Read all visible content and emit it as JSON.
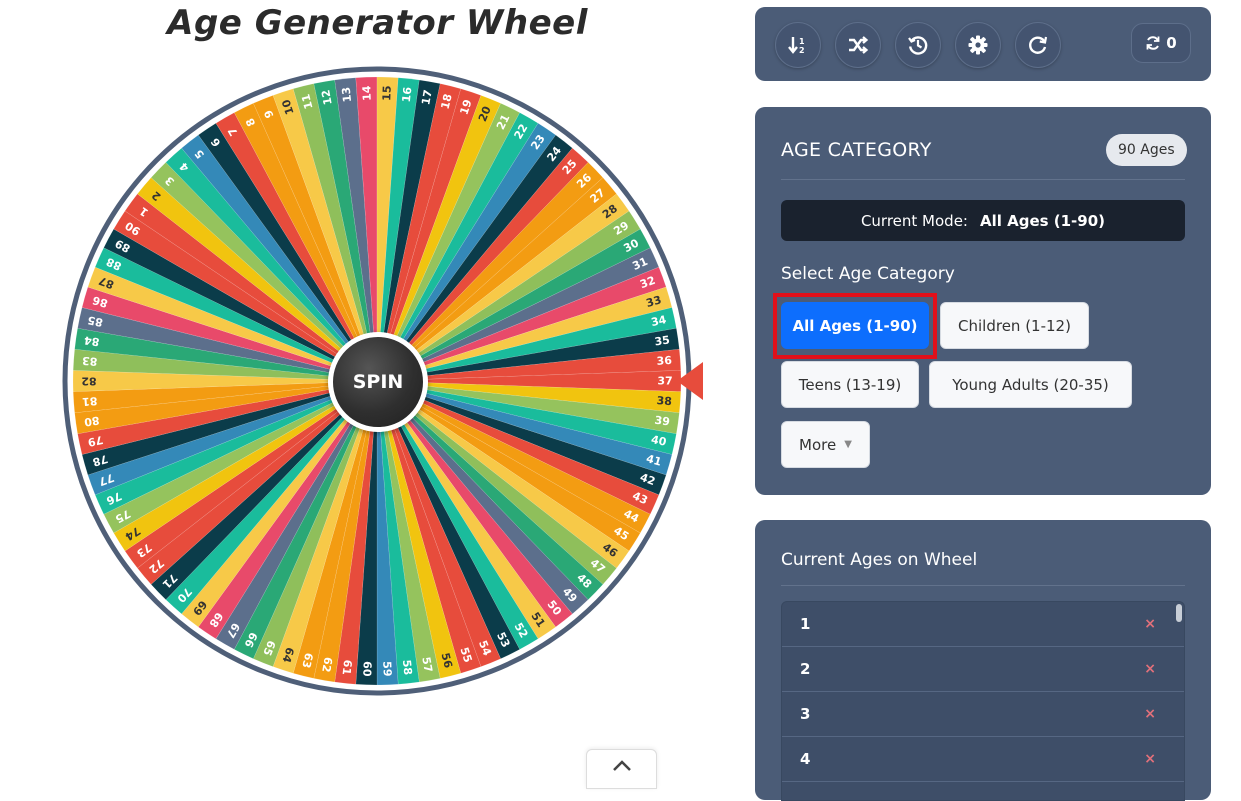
{
  "page_title": "Age Generator Wheel",
  "wheel": {
    "labels": [
      "1",
      "2",
      "3",
      "4",
      "5",
      "6",
      "7",
      "8",
      "9",
      "10",
      "11",
      "12",
      "13",
      "14",
      "15",
      "16",
      "17",
      "18",
      "19",
      "20",
      "21",
      "22",
      "23",
      "24",
      "25",
      "26",
      "27",
      "28",
      "29",
      "30",
      "31",
      "32",
      "33",
      "34",
      "35",
      "36",
      "37",
      "38",
      "39",
      "40",
      "41",
      "42",
      "43",
      "44",
      "45",
      "46",
      "47",
      "48",
      "49",
      "50",
      "51",
      "52",
      "53",
      "54",
      "55",
      "56",
      "57",
      "58",
      "59",
      "60",
      "61",
      "62",
      "63",
      "64",
      "65",
      "66",
      "67",
      "68",
      "69",
      "70",
      "71",
      "72",
      "73",
      "74",
      "75",
      "76",
      "77",
      "78",
      "79",
      "80",
      "81",
      "82",
      "83",
      "84",
      "85",
      "86",
      "87",
      "88",
      "89",
      "90"
    ],
    "palette": [
      "#e74c3c",
      "#f1c40f",
      "#95c35d",
      "#1abc9c",
      "#3489b8",
      "#0b3c4a",
      "#e74c3c",
      "#f39c12",
      "#f39c12",
      "#f7c948",
      "#8fbf5b",
      "#2aa876",
      "#5c6f8c",
      "#e84a6a",
      "#f7c948",
      "#1abc9c",
      "#0b3c4a",
      "#e74c3c"
    ],
    "spin_label": "SPIN",
    "pointer_color": "#e74c3c"
  },
  "toolbar": {
    "buttons": [
      "sort-icon",
      "shuffle-icon",
      "history-icon",
      "gear-icon",
      "refresh-icon"
    ],
    "spin_count": "0"
  },
  "category": {
    "heading": "AGE CATEGORY",
    "badge": "90 Ages",
    "mode_label": "Current Mode:",
    "mode_value": "All Ages (1-90)",
    "select_label": "Select Age Category",
    "buttons": {
      "all": "All Ages (1-90)",
      "children": "Children (1-12)",
      "teens": "Teens (13-19)",
      "young_adults": "Young Adults (20-35)",
      "more": "More"
    }
  },
  "current_list": {
    "heading": "Current Ages on Wheel",
    "rows": [
      "1",
      "2",
      "3",
      "4"
    ],
    "delete_glyph": "×"
  },
  "colors": {
    "panel": "#4b5c77",
    "active": "#0d6efd",
    "highlight": "#e0101a"
  }
}
